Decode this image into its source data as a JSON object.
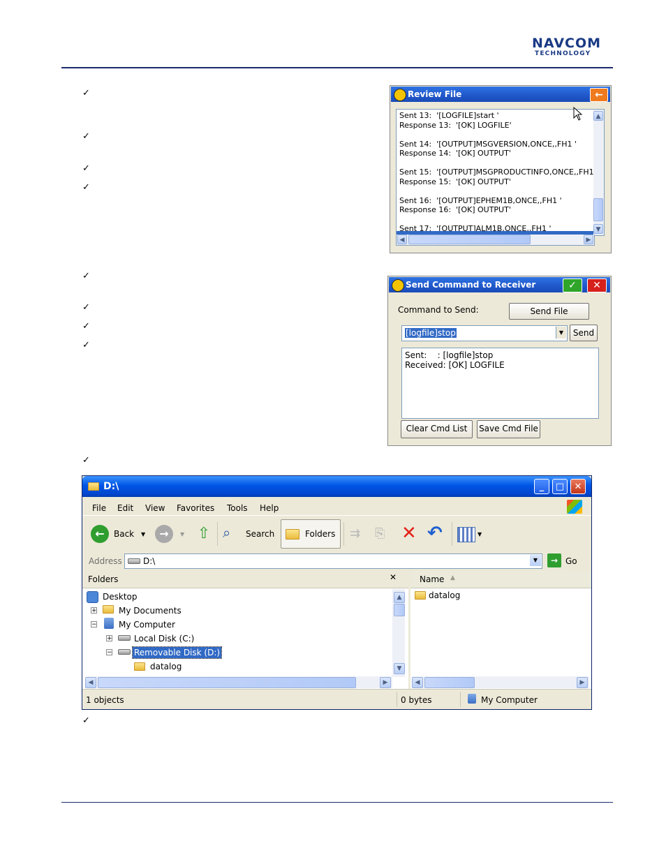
{
  "header": {
    "logo_line1": "NAVCOM",
    "logo_line2": "TECHNOLOGY"
  },
  "checkmark": "✓",
  "review_file": {
    "title": "Review File",
    "lines": [
      "Sent 13:  '[LOGFILE]start '",
      "Response 13:  '[OK] LOGFILE'",
      "",
      "Sent 14:  '[OUTPUT]MSGVERSION,ONCE,,FH1 '",
      "Response 14:  '[OK] OUTPUT'",
      "",
      "Sent 15:  '[OUTPUT]MSGPRODUCTINFO,ONCE,,FH1",
      "Response 15:  '[OK] OUTPUT'",
      "",
      "Sent 16:  '[OUTPUT]EPHEM1B,ONCE,,FH1 '",
      "Response 16:  '[OK] OUTPUT'",
      "",
      "Sent 17:  '[OUTPUT]ALM1B,ONCE,,FH1 '"
    ],
    "back_glyph": "←"
  },
  "send_command": {
    "title": "Send Command to Receiver",
    "ok_glyph": "✓",
    "close_glyph": "✕",
    "label": "Command to Send:",
    "send_file_button": "Send File",
    "command_value": "[logfile]stop",
    "send_button": "Send",
    "output_lines": [
      "Sent:    : [logfile]stop",
      "Received: [OK] LOGFILE"
    ],
    "clear_button": "Clear Cmd List",
    "save_button": "Save Cmd File"
  },
  "explorer": {
    "title": "D:\\",
    "menu": [
      "File",
      "Edit",
      "View",
      "Favorites",
      "Tools",
      "Help"
    ],
    "toolbar": {
      "back": "Back",
      "search": "Search",
      "folders": "Folders"
    },
    "address_label": "Address",
    "address_value": "D:\\",
    "go_label": "Go",
    "folders_header": "Folders",
    "folders_close": "✕",
    "tree": {
      "desktop": "Desktop",
      "my_documents": "My Documents",
      "my_computer": "My Computer",
      "local_disk": "Local Disk (C:)",
      "removable_disk": "Removable Disk (D:)",
      "datalog": "datalog"
    },
    "name_column": "Name",
    "files": [
      "datalog"
    ],
    "status": {
      "objects": "1 objects",
      "size": "0 bytes",
      "location": "My Computer"
    }
  },
  "colors": {
    "navcom_blue": "#1a3a85",
    "xp_title": "#0055e5",
    "selection": "#316ac5"
  }
}
